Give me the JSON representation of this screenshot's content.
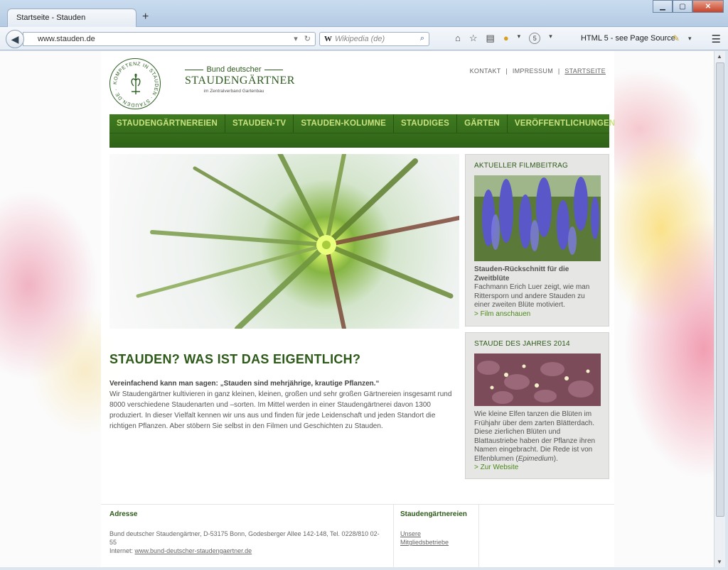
{
  "browser": {
    "tab_title": "Startseite - Stauden",
    "new_tab_symbol": "+",
    "url": "www.stauden.de",
    "search_engine": "W",
    "search_placeholder": "Wikipedia (de)",
    "badge_count": "5",
    "html5_button": "HTML 5 - see Page Source"
  },
  "header": {
    "logo_ring_text": "KOMPETENZ IN STAUDEN · STAUDEN.DE ·",
    "brand_top": "Bund deutscher",
    "brand_main": "STAUDENGÄRTNER",
    "brand_sub": "im Zentralverband Gartenbau",
    "toplinks": [
      "KONTAKT",
      "IMPRESSUM",
      "STARTSEITE"
    ],
    "separator": "|"
  },
  "nav": {
    "items": [
      "STAUDENGÄRTNEREIEN",
      "STAUDEN-TV",
      "STAUDEN-KOLUMNE",
      "STAUDIGES",
      "GÄRTEN",
      "VERÖFFENTLICHUNGEN"
    ]
  },
  "main": {
    "heading": "STAUDEN? WAS IST DAS EIGENTLICH?",
    "lead": "Vereinfachend kann man sagen: „Stauden sind mehrjährige, krautige Pflanzen.“",
    "body": "Wir Staudengärtner kultivieren in ganz kleinen, kleinen, großen und sehr großen Gärtnereien insgesamt rund 8000 verschiedene Staudenarten und –sorten. Im Mittel werden in einer Staudengärtnerei davon 1300 produziert. In dieser Vielfalt kennen wir uns aus und finden für jede Leidenschaft und jeden Standort die richtigen Pflanzen. Aber stöbern Sie selbst in den Filmen und Geschichten zu Stauden."
  },
  "sidebar": {
    "film": {
      "title": "AKTUELLER FILMBEITRAG",
      "headline": "Stauden-Rückschnitt für die Zweitblüte",
      "text": "Fachmann Erich Luer zeigt, wie man Rittersporn und andere Stauden zu einer zweiten Blüte motiviert.",
      "link": "> Film anschauen"
    },
    "plant": {
      "title": "STAUDE DES JAHRES 2014",
      "text_before": "Wie kleine Elfen tanzen die Blüten im Frühjahr über dem zarten Blätterdach. Diese zierlichen Blüten und Blattaustriebe haben der Pflanze ihren Namen eingebracht. Die Rede ist von Elfenblumen (",
      "text_italic": "Epimedium",
      "text_after": ").",
      "link": "> Zur Website"
    }
  },
  "footer": {
    "address_heading": "Adresse",
    "address_line": "Bund deutscher Staudengärtner, D-53175 Bonn, Godesberger Allee 142-148, Tel. 0228/810 02-55",
    "internet_label": "Internet:",
    "internet_url": "www.bund-deutscher-staudengaertner.de",
    "nurseries_heading": "Staudengärtnereien",
    "nurseries_link": "Unsere Mitgliedsbetriebe"
  },
  "colors": {
    "brand_green": "#2d5a19",
    "nav_green": "#3f7a20",
    "nav_text": "#c9e27f",
    "link_green": "#4c8a1b"
  }
}
